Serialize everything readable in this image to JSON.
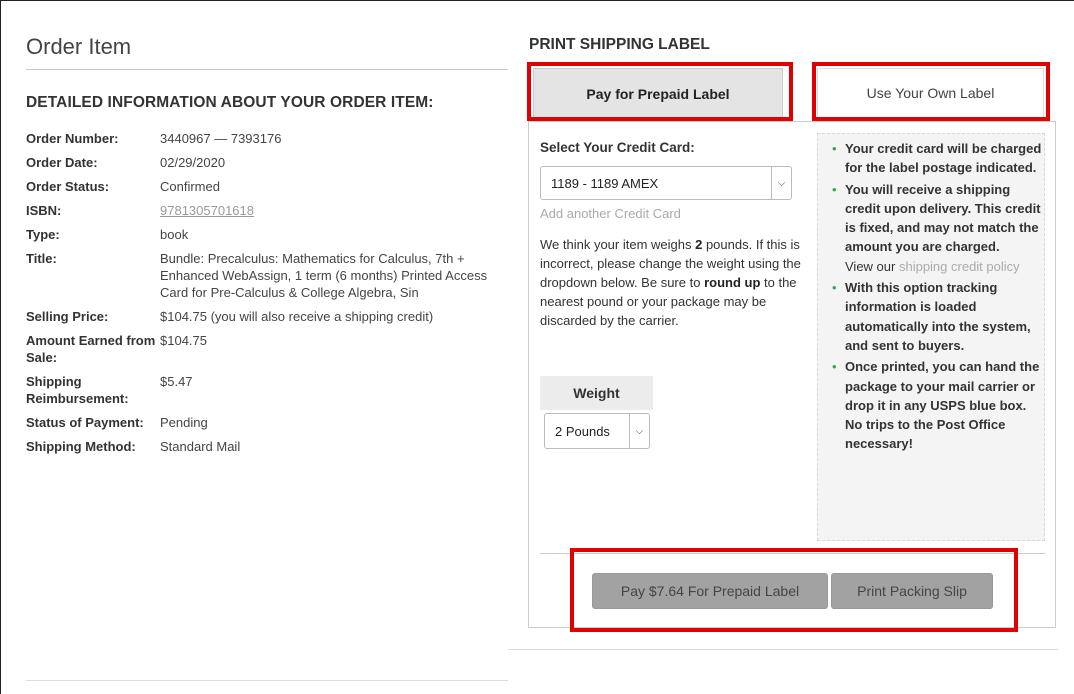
{
  "left": {
    "title": "Order Item",
    "section_heading": "DETAILED INFORMATION ABOUT YOUR ORDER ITEM:",
    "rows": [
      {
        "label": "Order Number:",
        "value": "3440967 — 7393176"
      },
      {
        "label": "Order Date:",
        "value": "02/29/2020"
      },
      {
        "label": "Order Status:",
        "value": "Confirmed"
      },
      {
        "label": "ISBN:",
        "value": "9781305701618"
      },
      {
        "label": "Type:",
        "value": "book"
      },
      {
        "label": "Title:",
        "value": "Bundle: Precalculus: Mathematics for Calculus, 7th + Enhanced WebAssign, 1 term (6 months) Printed Access Card for Pre-Calculus & College Algebra, Sin"
      },
      {
        "label": "Selling Price:",
        "value": "$104.75 (you will also receive a shipping credit)"
      },
      {
        "label": "Amount Earned from Sale:",
        "value": "$104.75"
      },
      {
        "label": "Shipping Reimbursement:",
        "value": "$5.47"
      },
      {
        "label": "Status of Payment:",
        "value": "Pending"
      },
      {
        "label": "Shipping Method:",
        "value": "Standard Mail"
      }
    ]
  },
  "right": {
    "title": "PRINT SHIPPING LABEL",
    "tabs": [
      {
        "label": "Pay for Prepaid Label",
        "active": true
      },
      {
        "label": "Use Your Own Label",
        "active": false
      }
    ],
    "credit_card_label": "Select Your Credit Card:",
    "credit_card_selected": "1189 - 1189 AMEX",
    "add_card_link": "Add another Credit Card",
    "weight_text": {
      "part1": "We think your item weighs ",
      "weight_bold": "2",
      "part2": " pounds. If this is incorrect, please change the weight using the dropdown below. Be sure to ",
      "round_up": "round up",
      "part3": " to the nearest pound or your package may be discarded by the carrier."
    },
    "weight_header": "Weight",
    "weight_selected": "2 Pounds",
    "info": {
      "item1": "Your credit card will be charged for the label postage indicated.",
      "item2_a": "You will receive a shipping credit upon delivery. ",
      "item2_bold": "This credit is fixed, and may not match the amount you are charged.",
      "item2_view": "View our ",
      "item2_link": "shipping credit policy",
      "item3": "With this option tracking information is loaded automatically into the system, and sent to buyers.",
      "item4": "Once printed, you can hand the package to your mail carrier or drop it in any USPS blue box. No trips to the Post Office necessary!"
    },
    "buttons": {
      "pay": "Pay $7.64 For Prepaid Label",
      "slip": "Print Packing Slip"
    }
  },
  "colors": {
    "highlight": "#e00000",
    "bullet": "#3aa64a",
    "button_bg": "#a2a2a2",
    "active_tab_bg": "#e4e4e4"
  },
  "icons": {
    "dropdown": "chevron-down-icon"
  }
}
